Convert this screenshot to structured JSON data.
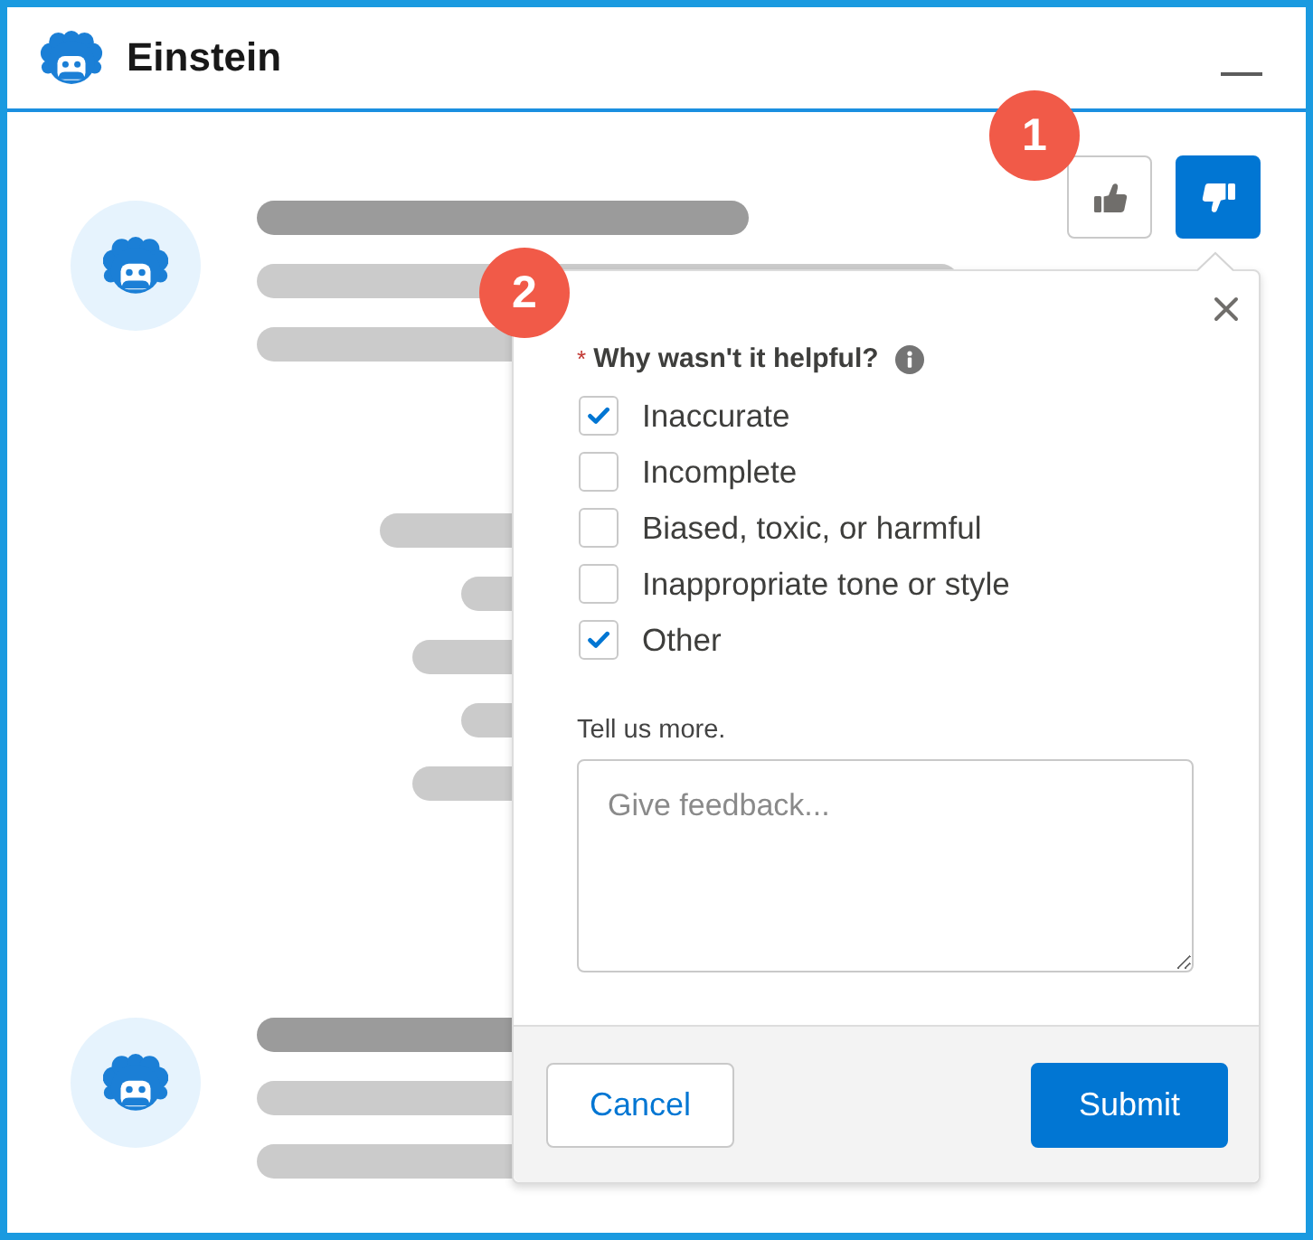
{
  "window": {
    "title": "Einstein"
  },
  "conversation": [
    {
      "kind": "bot",
      "rating": [
        {
          "kind": "thumbs_up",
          "selected": false
        },
        {
          "kind": "thumbs_down",
          "selected": true
        }
      ]
    },
    {
      "kind": "user"
    },
    {
      "kind": "bot"
    }
  ],
  "feedback_popover": {
    "question": {
      "required_mark": "*",
      "label": "Why wasn't it helpful?"
    },
    "options": [
      {
        "label": "Inaccurate",
        "checked": true
      },
      {
        "label": "Incomplete",
        "checked": false
      },
      {
        "label": "Biased, toxic, or harmful",
        "checked": false
      },
      {
        "label": "Inappropriate tone or style",
        "checked": false
      },
      {
        "label": "Other",
        "checked": true
      }
    ],
    "comment": {
      "label": "Tell us more.",
      "placeholder": "Give feedback..."
    },
    "buttons": [
      {
        "kind": "neutral",
        "label": "Cancel"
      },
      {
        "kind": "brand",
        "label": "Submit"
      }
    ]
  },
  "callouts": [
    "1",
    "2"
  ]
}
